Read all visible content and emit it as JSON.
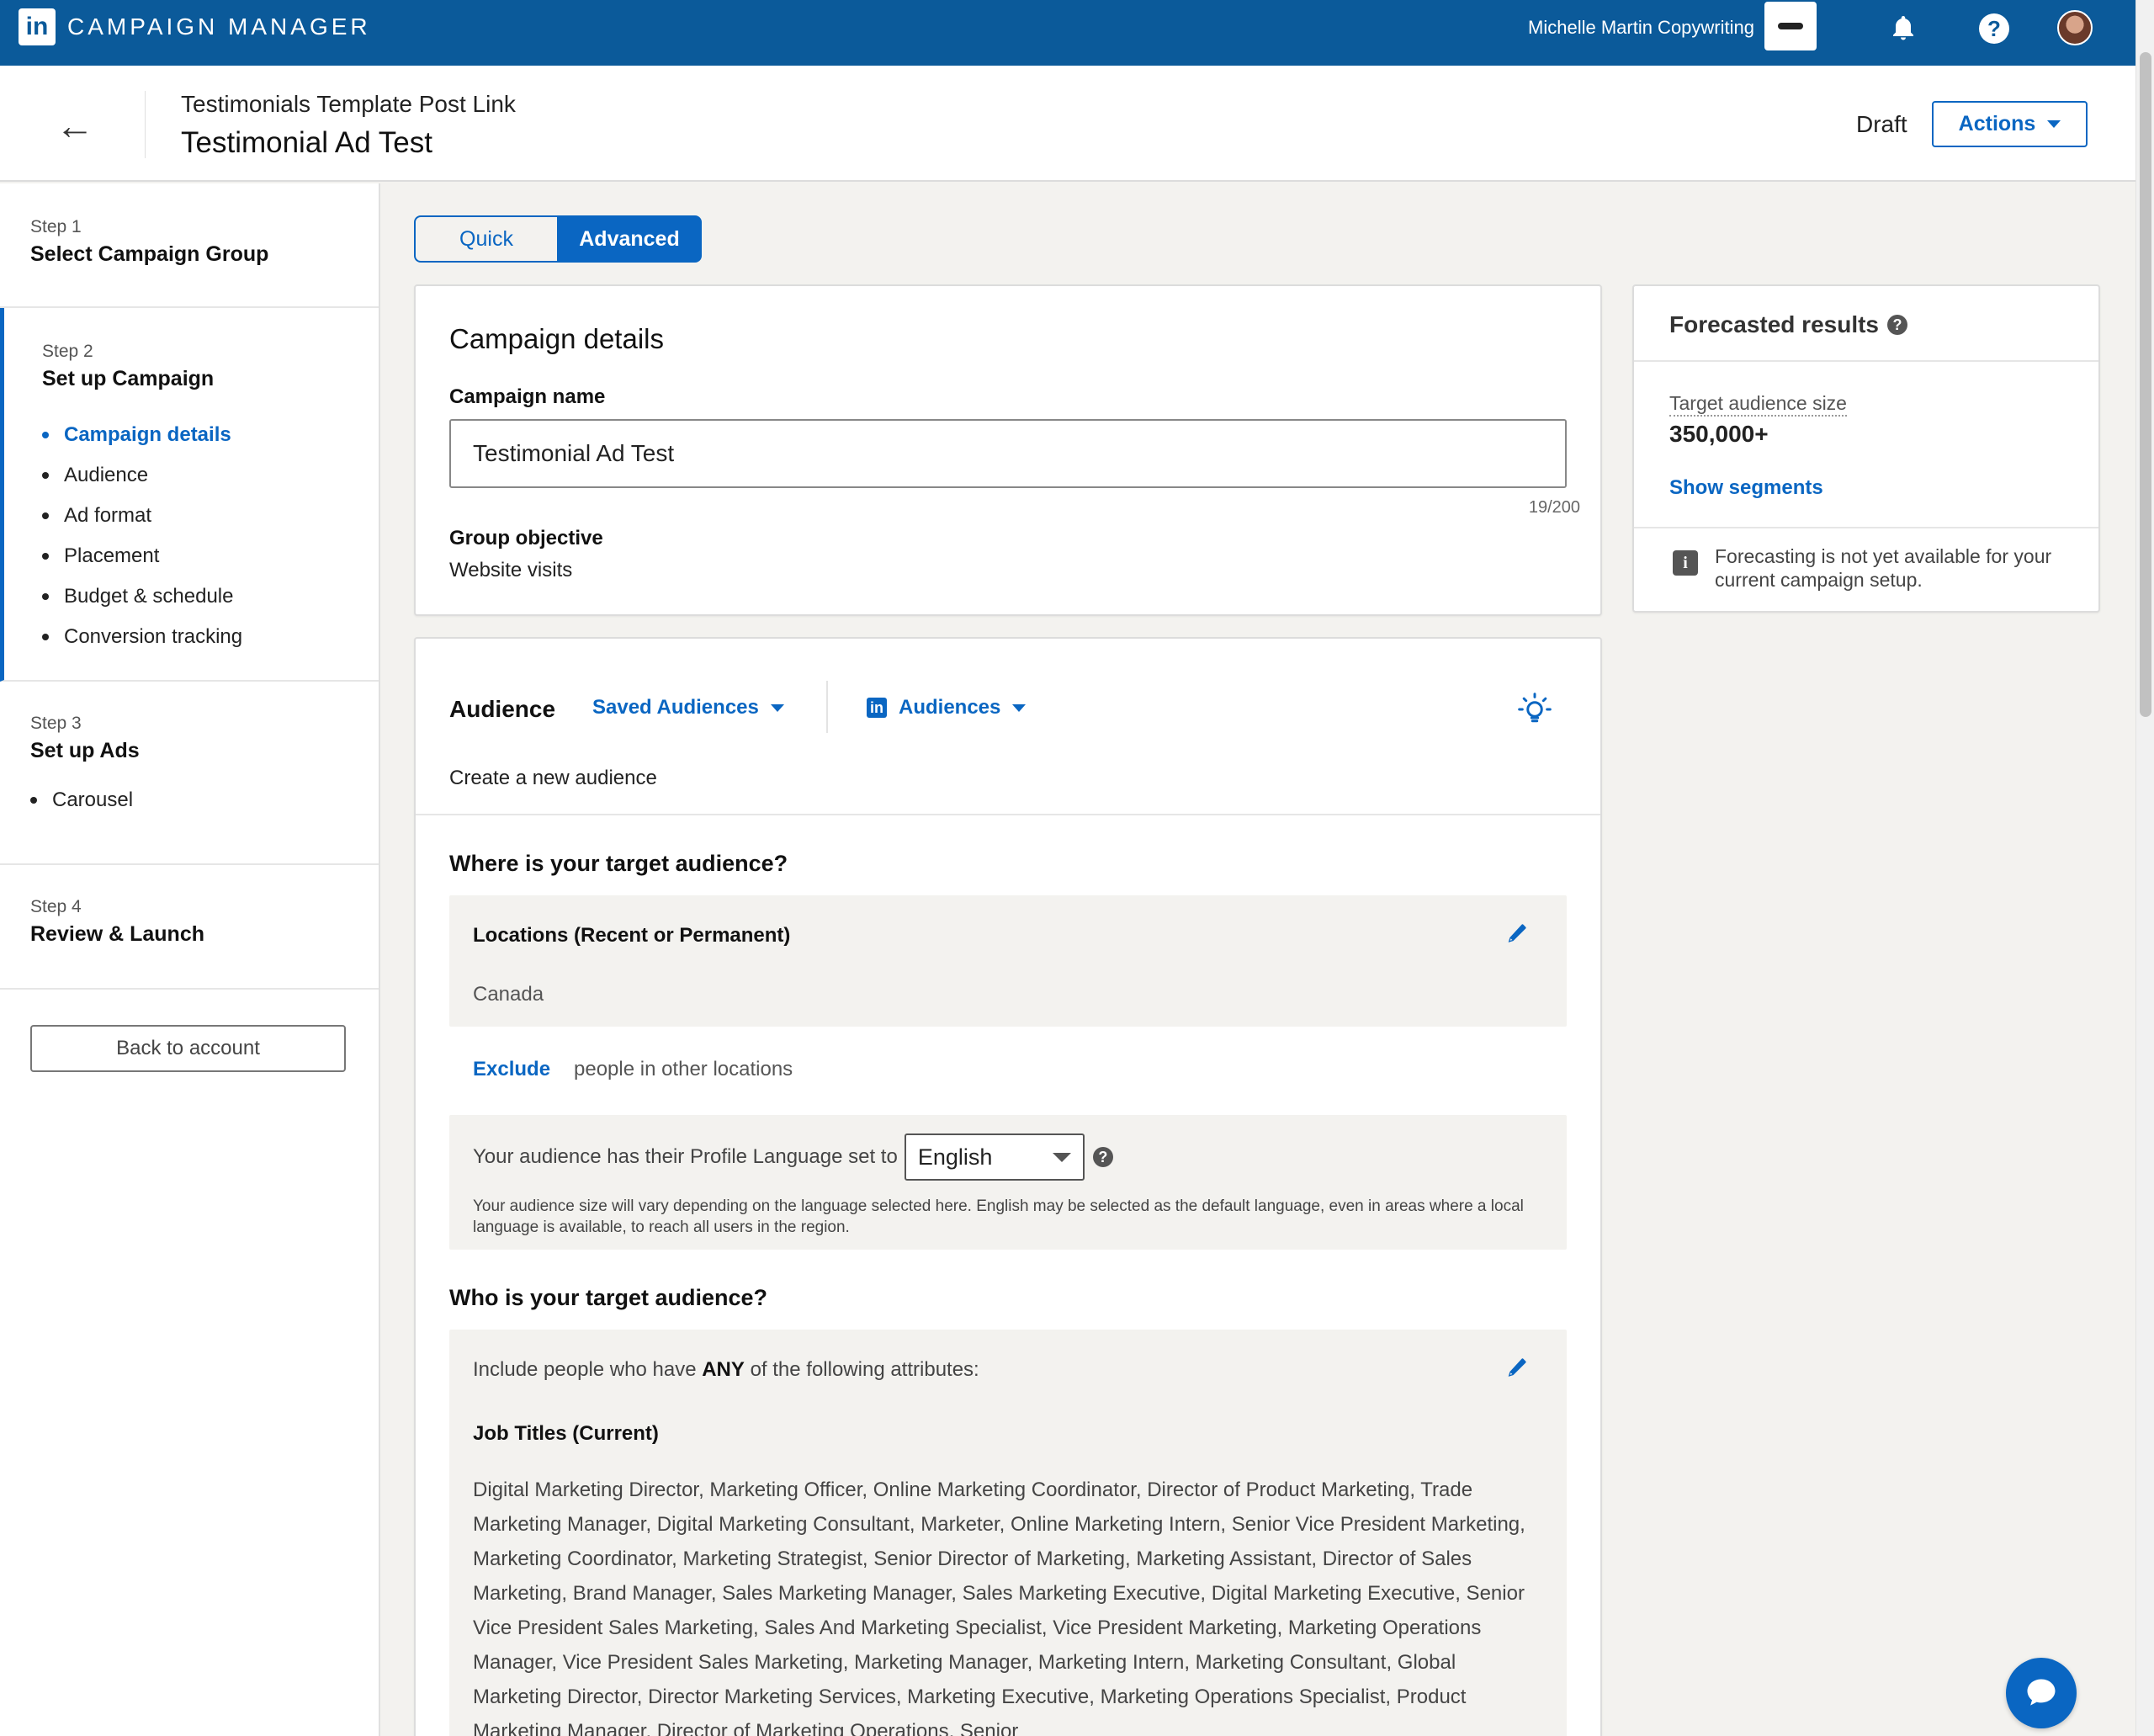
{
  "topnav": {
    "logo_text": "in",
    "app_name": "CAMPAIGN MANAGER",
    "account_name": "Michelle Martin Copywriting"
  },
  "header": {
    "breadcrumb": "Testimonials Template Post Link",
    "title": "Testimonial Ad Test",
    "status": "Draft",
    "actions_label": "Actions"
  },
  "sidebar": {
    "step1": {
      "num": "Step 1",
      "title": "Select Campaign Group"
    },
    "step2": {
      "num": "Step 2",
      "title": "Set up Campaign",
      "items": [
        "Campaign details",
        "Audience",
        "Ad format",
        "Placement",
        "Budget & schedule",
        "Conversion tracking"
      ]
    },
    "step3": {
      "num": "Step 3",
      "title": "Set up Ads",
      "items": [
        "Carousel"
      ]
    },
    "step4": {
      "num": "Step 4",
      "title": "Review & Launch"
    },
    "back_label": "Back to account"
  },
  "mode_toggle": {
    "quick": "Quick",
    "advanced": "Advanced",
    "selected": "Advanced"
  },
  "campaign_details": {
    "heading": "Campaign details",
    "name_label": "Campaign name",
    "name_value": "Testimonial Ad Test",
    "counter": "19/200",
    "objective_label": "Group objective",
    "objective_value": "Website visits"
  },
  "forecast": {
    "title": "Forecasted results",
    "audience_label": "Target audience size",
    "audience_value": "350,000+",
    "segments_link": "Show segments",
    "note": "Forecasting is not yet available for your current campaign setup."
  },
  "audience": {
    "heading": "Audience",
    "saved_dropdown": "Saved Audiences",
    "audiences_dropdown": "Audiences",
    "create_new": "Create a new audience",
    "where_heading": "Where is your target audience?",
    "locations_label": "Locations (Recent or Permanent)",
    "locations_value": "Canada",
    "exclude_link": "Exclude",
    "exclude_note": "people in other locations",
    "language_prefix": "Your audience has their Profile Language set to",
    "language_value": "English",
    "language_note": "Your audience size will vary depending on the language selected here. English may be selected as the default language, even in areas where a local language is available, to reach all users in the region.",
    "who_heading": "Who is your target audience?",
    "include_prefix": "Include people who have",
    "include_emph": "ANY",
    "include_suffix": "of the following attributes:",
    "jobs_label": "Job Titles (Current)",
    "jobs_value": "Digital Marketing Director, Marketing Officer, Online Marketing Coordinator, Director of Product Marketing, Trade Marketing Manager, Digital Marketing Consultant, Marketer, Online Marketing Intern, Senior Vice President Marketing, Marketing Coordinator, Marketing Strategist, Senior Director of Marketing, Marketing Assistant, Director of Sales Marketing, Brand Manager, Sales Marketing Manager, Sales Marketing Executive, Digital Marketing Executive, Senior Vice President Sales Marketing, Sales And Marketing Specialist, Vice President Marketing, Marketing Operations Manager, Vice President Sales Marketing, Marketing Manager, Marketing Intern, Marketing Consultant, Global Marketing Director, Director Marketing Services, Marketing Executive, Marketing Operations Specialist, Product Marketing Manager, Director of Marketing Operations, Senior"
  },
  "colors": {
    "nav": "#0b5a9a",
    "accent": "#0a66c2",
    "page_bg": "#f3f2ef"
  }
}
